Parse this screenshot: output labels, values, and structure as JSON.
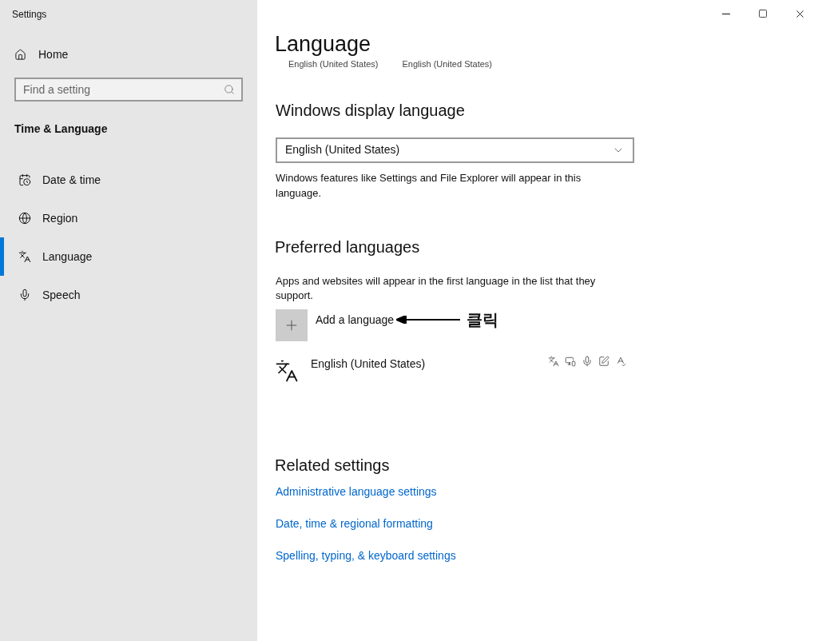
{
  "window": {
    "title": "Settings"
  },
  "sidebar": {
    "home": "Home",
    "search": {
      "placeholder": "Find a setting"
    },
    "section": "Time & Language",
    "items": [
      {
        "label": "Date & time",
        "kind": "calendar",
        "selected": false
      },
      {
        "label": "Region",
        "kind": "globe",
        "selected": false
      },
      {
        "label": "Language",
        "kind": "language",
        "selected": true
      },
      {
        "label": "Speech",
        "kind": "mic",
        "selected": false
      }
    ]
  },
  "page": {
    "title": "Language",
    "subtitles": [
      "English (United States)",
      "English (United States)"
    ],
    "display": {
      "heading": "Windows display language",
      "dropdown": "English (United States)",
      "note": "Windows features like Settings and File Explorer will appear in this language."
    },
    "preferred": {
      "heading": "Preferred languages",
      "note": "Apps and websites will appear in the first language in the list that they support.",
      "add": "Add a language",
      "annotation": "클릭",
      "languages": [
        {
          "name": "English (United States)"
        }
      ]
    },
    "related": {
      "heading": "Related settings",
      "links": [
        "Administrative language settings",
        "Date, time & regional formatting",
        "Spelling, typing, & keyboard settings"
      ]
    }
  }
}
